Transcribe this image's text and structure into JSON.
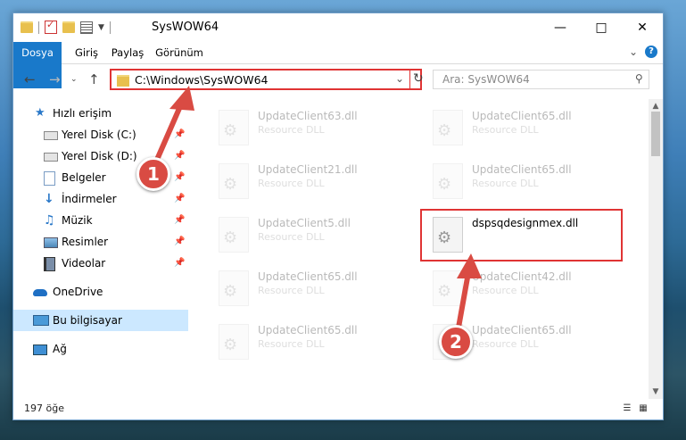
{
  "window": {
    "title": "SysWOW64"
  },
  "ribbon": {
    "tabs": [
      "Dosya",
      "Giriş",
      "Paylaş",
      "Görünüm"
    ]
  },
  "address": {
    "path": "C:\\Windows\\SysWOW64"
  },
  "search": {
    "placeholder": "Ara: SysWOW64"
  },
  "nav": {
    "items": [
      {
        "label": "Hızlı erişim",
        "icon": "star-icon"
      },
      {
        "label": "Yerel Disk (C:)",
        "icon": "drive-icon",
        "pinned": true
      },
      {
        "label": "Yerel Disk (D:)",
        "icon": "drive-icon",
        "pinned": true
      },
      {
        "label": "Belgeler",
        "icon": "documents-icon",
        "pinned": true
      },
      {
        "label": "İndirmeler",
        "icon": "download-icon",
        "pinned": true
      },
      {
        "label": "Müzik",
        "icon": "music-icon",
        "pinned": true
      },
      {
        "label": "Resimler",
        "icon": "pictures-icon",
        "pinned": true
      },
      {
        "label": "Videolar",
        "icon": "videos-icon",
        "pinned": true
      },
      {
        "label": "OneDrive",
        "icon": "cloud-icon"
      },
      {
        "label": "Bu bilgisayar",
        "icon": "computer-icon",
        "selected": true
      },
      {
        "label": "Ağ",
        "icon": "network-icon"
      }
    ]
  },
  "files": [
    {
      "name": "UpdateClient63.dll",
      "type": "Resource DLL",
      "faded": true
    },
    {
      "name": "UpdateClient65.dll",
      "type": "Resource DLL",
      "faded": true
    },
    {
      "name": "UpdateClient21.dll",
      "type": "Resource DLL",
      "faded": true
    },
    {
      "name": "UpdateClient65.dll",
      "type": "Resource DLL",
      "faded": true
    },
    {
      "name": "UpdateClient5.dll",
      "type": "Resource DLL",
      "faded": true
    },
    {
      "name": "dspsqdesignmex.dll",
      "type": "",
      "faded": false,
      "highlighted": true
    },
    {
      "name": "UpdateClient65.dll",
      "type": "Resource DLL",
      "faded": true
    },
    {
      "name": "UpdateClient42.dll",
      "type": "Resource DLL",
      "faded": true
    },
    {
      "name": "UpdateClient65.dll",
      "type": "Resource DLL",
      "faded": true
    },
    {
      "name": "UpdateClient65.dll",
      "type": "Resource DLL",
      "faded": true
    }
  ],
  "status": {
    "count": "197 öğe"
  },
  "callouts": [
    "1",
    "2"
  ],
  "colors": {
    "accent": "#1979ca",
    "highlight": "#e03434",
    "callout": "#d94b43"
  }
}
